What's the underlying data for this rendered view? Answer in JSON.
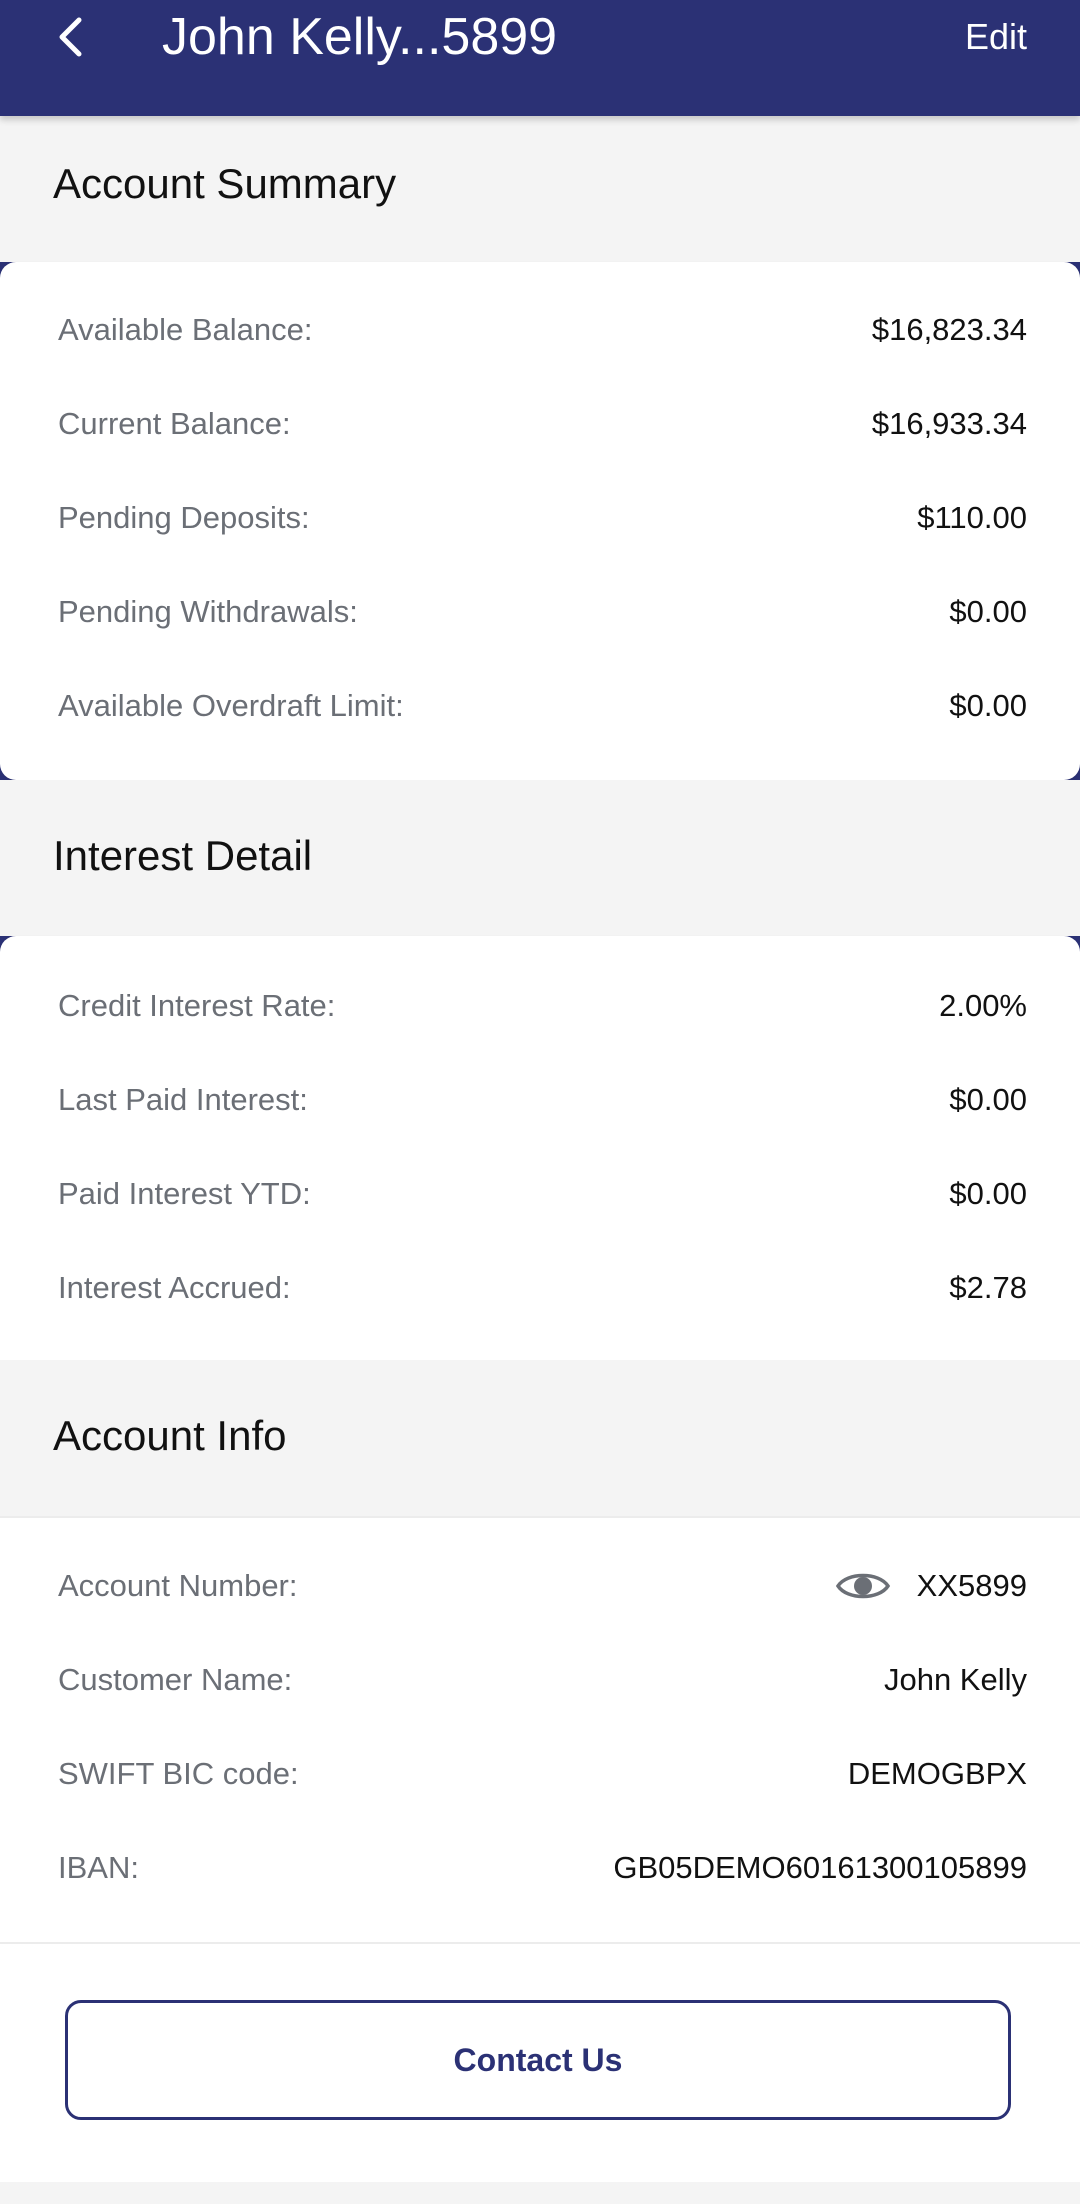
{
  "header": {
    "title": "John Kelly...5899",
    "edit_label": "Edit",
    "back_icon": "chevron-left-icon"
  },
  "account_summary": {
    "title": "Account Summary",
    "rows": [
      {
        "label": "Available Balance:",
        "value": "$16,823.34"
      },
      {
        "label": "Current Balance:",
        "value": "$16,933.34"
      },
      {
        "label": "Pending Deposits:",
        "value": "$110.00"
      },
      {
        "label": "Pending Withdrawals:",
        "value": "$0.00"
      },
      {
        "label": "Available Overdraft Limit:",
        "value": "$0.00"
      }
    ]
  },
  "interest_detail": {
    "title": "Interest Detail",
    "rows": [
      {
        "label": "Credit Interest Rate:",
        "value": "2.00%"
      },
      {
        "label": "Last Paid Interest:",
        "value": "$0.00"
      },
      {
        "label": "Paid Interest YTD:",
        "value": "$0.00"
      },
      {
        "label": "Interest Accrued:",
        "value": "$2.78"
      }
    ]
  },
  "account_info": {
    "title": "Account Info",
    "rows": [
      {
        "label": "Account Number:",
        "value": "XX5899",
        "icon": "eye-icon"
      },
      {
        "label": "Customer Name:",
        "value": "John Kelly"
      },
      {
        "label": "SWIFT BIC code:",
        "value": "DEMOGBPX"
      },
      {
        "label": "IBAN:",
        "value": "GB05DEMO60161300105899"
      }
    ]
  },
  "contact": {
    "label": "Contact Us"
  },
  "colors": {
    "brand_navy": "#2b3175",
    "background": "#f4f4f4",
    "card": "#ffffff",
    "label_gray": "#6b6f76"
  }
}
